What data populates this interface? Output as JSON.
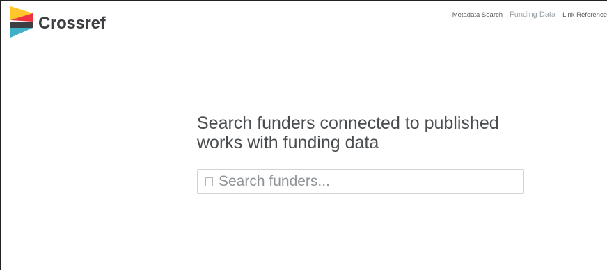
{
  "brand": {
    "name": "Crossref",
    "colors": {
      "yellow": "#ffc72c",
      "red": "#ef3340",
      "dark": "#3e3f42",
      "teal": "#3eb1c8"
    }
  },
  "nav": {
    "items": [
      {
        "label": "Metadata Search",
        "active": false
      },
      {
        "label": "Funding Data",
        "active": true
      },
      {
        "label": "Link Reference",
        "active": false
      }
    ]
  },
  "main": {
    "heading_line1": "Search funders connected to published",
    "heading_line2": "works with funding data"
  },
  "search": {
    "placeholder": "Search funders...",
    "value": "",
    "icon": "search-icon"
  }
}
